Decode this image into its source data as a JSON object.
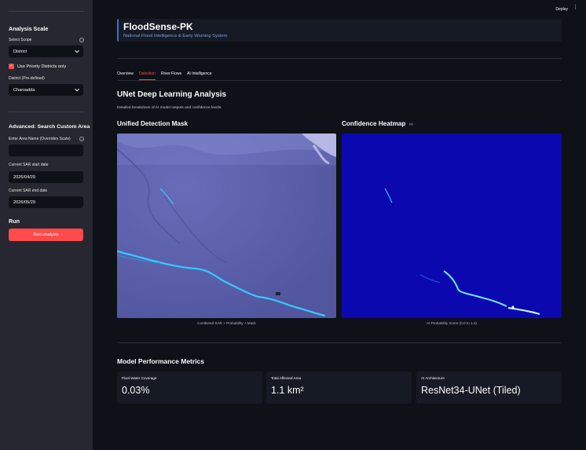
{
  "sidebar": {
    "analysis_scale_heading": "Analysis Scale",
    "select_scope_label": "Select Scope",
    "select_scope_value": "District",
    "priority_checkbox_label": "Use Priority Districts only",
    "district_label": "District (Pre-defined)",
    "district_value": "Charsadda",
    "advanced_heading": "Advanced: Search Custom Area",
    "area_name_label": "Enter Area Name (Overrides Scale)",
    "area_name_value": "",
    "sar_start_label": "Current SAR start date",
    "sar_start_value": "2026/04/29",
    "sar_end_label": "Current SAR end date",
    "sar_end_value": "2026/05/29",
    "run_heading": "Run",
    "run_button_label": "Run analysis",
    "help_glyph": "?",
    "check_glyph": "✓"
  },
  "topbar": {
    "deploy_label": "Deploy",
    "menu_glyph": "⋮"
  },
  "header": {
    "title": "FloodSense-PK",
    "subtitle": "National Flood Intelligence & Early Warning System"
  },
  "tabs": [
    {
      "label": "Overview",
      "active": false
    },
    {
      "label": "Detection",
      "active": true
    },
    {
      "label": "River Flows",
      "active": false
    },
    {
      "label": "AI Intelligence",
      "active": false
    }
  ],
  "detection": {
    "title": "UNet Deep Learning Analysis",
    "description": "Detailed breakdown of AI model outputs and confidence levels.",
    "mask_title": "Unified Detection Mask",
    "mask_caption": "Combined SAR + Probability + Mask",
    "heatmap_title": "Confidence Heatmap",
    "heatmap_link_glyph": "∞",
    "heatmap_caption": "AI Probability Score (0.0 to 1.0)"
  },
  "metrics": {
    "title": "Model Performance Metrics",
    "items": [
      {
        "label": "Pixel Water Coverage",
        "value": "0.03%"
      },
      {
        "label": "Total Affected Area",
        "value": "1.1 km²"
      },
      {
        "label": "AI Architecture",
        "value": "ResNet34-UNet (Tiled)"
      }
    ]
  },
  "colors": {
    "accent": "#ff4b4b",
    "sidebar_bg": "#262730",
    "main_bg": "#0e1117",
    "mask_overlay": "#5b5fb0",
    "heatmap_bg": "#0a08a8",
    "water_highlight": "#34c9ff"
  }
}
